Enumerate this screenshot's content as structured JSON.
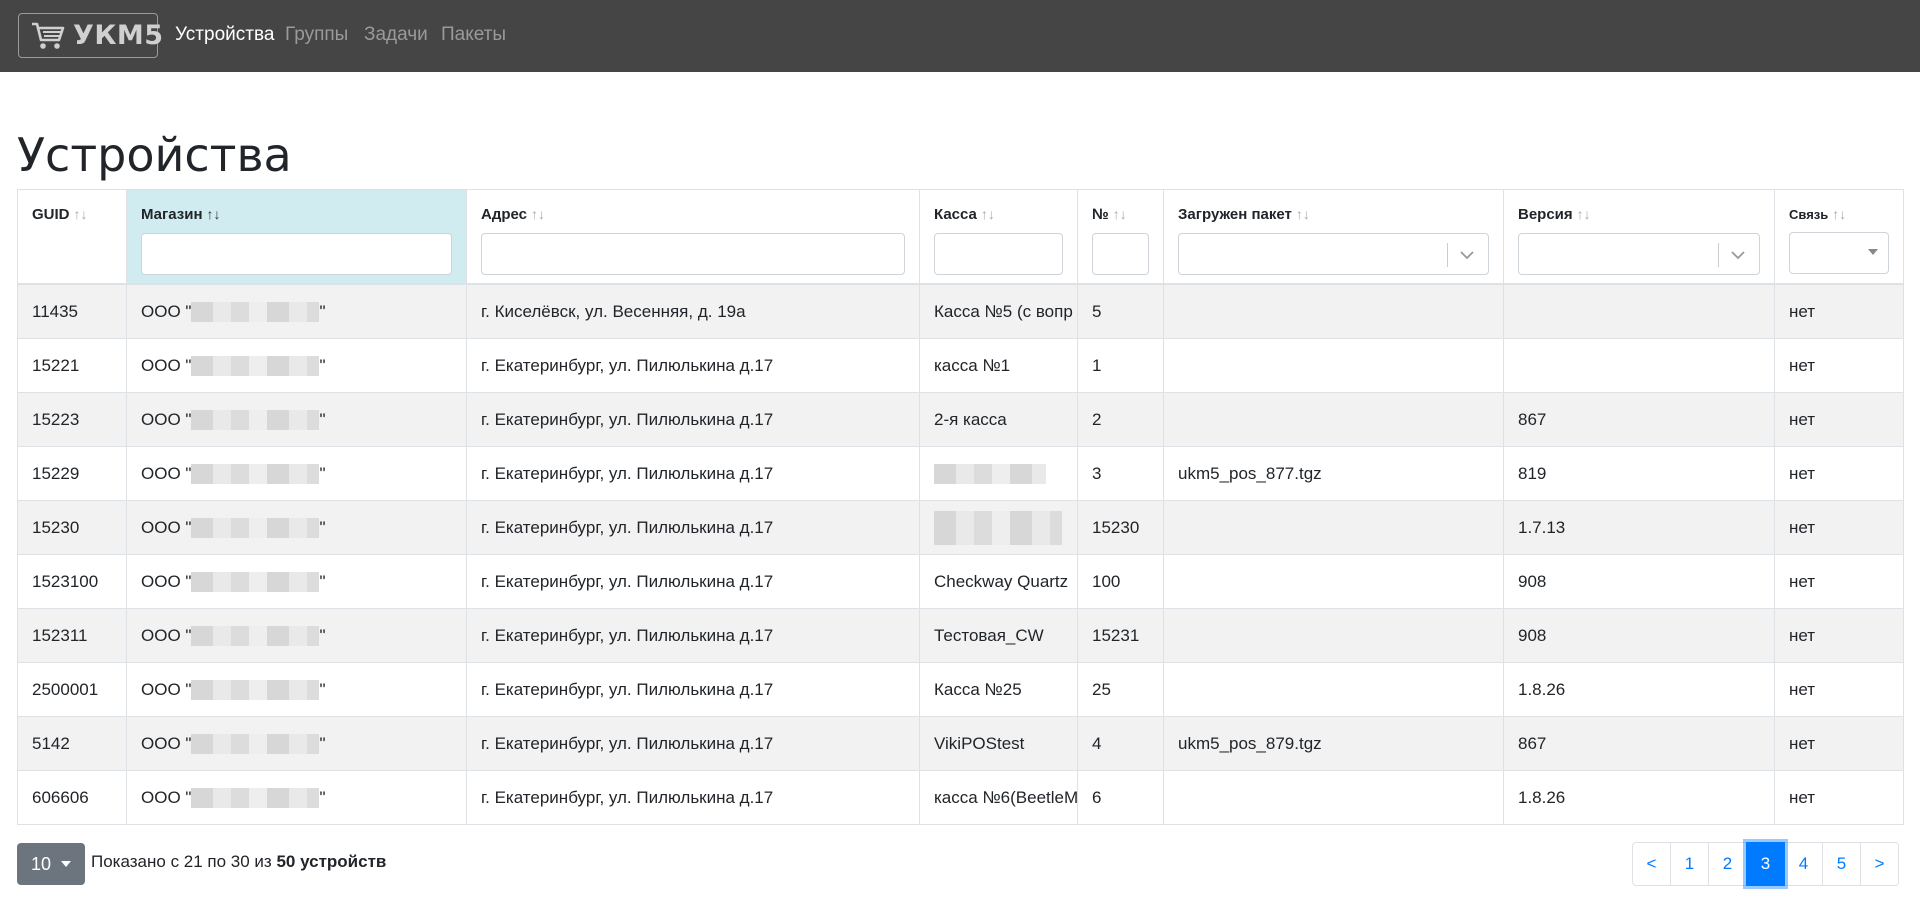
{
  "brand": {
    "name": "УКМ5",
    "icon": "shopping-cart-icon"
  },
  "nav": {
    "items": [
      {
        "label": "Устройства",
        "active": true
      },
      {
        "label": "Группы",
        "active": false
      },
      {
        "label": "Задачи",
        "active": false
      },
      {
        "label": "Пакеты",
        "active": false
      }
    ]
  },
  "page": {
    "title": "Устройства"
  },
  "table": {
    "columns": [
      {
        "label": "GUID",
        "sort": "↑↓",
        "filter": "none"
      },
      {
        "label": "Магазин",
        "sort": "↑↓",
        "filter": "text",
        "sorted": true
      },
      {
        "label": "Адрес",
        "sort": "↑↓",
        "filter": "text"
      },
      {
        "label": "Касса",
        "sort": "↑↓",
        "filter": "text"
      },
      {
        "label": "№",
        "sort": "↑↓",
        "filter": "text"
      },
      {
        "label": "Загружен пакет",
        "sort": "↑↓",
        "filter": "select"
      },
      {
        "label": "Версия",
        "sort": "↑↓",
        "filter": "select"
      },
      {
        "label": "Связь",
        "sort": "↑↓",
        "filter": "native-select"
      }
    ],
    "rows": [
      {
        "guid": "11435",
        "shop_prefix": "ООО \"",
        "shop_suffix": "\"",
        "address": "г. Киселёвск, ул. Весенняя, д. 19а",
        "kassa": "Касса №5 (с вопр",
        "num": "5",
        "package": "",
        "version": "",
        "link": "нет"
      },
      {
        "guid": "15221",
        "shop_prefix": "ООО \"",
        "shop_suffix": "\"",
        "address": "г. Екатеринбург, ул. Пилюлькина д.17",
        "kassa": "касса №1",
        "num": "1",
        "package": "",
        "version": "",
        "link": "нет"
      },
      {
        "guid": "15223",
        "shop_prefix": "ООО \"",
        "shop_suffix": "\"",
        "address": "г. Екатеринбург, ул. Пилюлькина д.17",
        "kassa": "2-я касса",
        "num": "2",
        "package": "",
        "version": "867",
        "link": "нет"
      },
      {
        "guid": "15229",
        "shop_prefix": "ООО \"",
        "shop_suffix": "\"",
        "address": "г. Екатеринбург, ул. Пилюлькина д.17",
        "kassa": "",
        "num": "3",
        "package": "ukm5_pos_877.tgz",
        "version": "819",
        "link": "нет"
      },
      {
        "guid": "15230",
        "shop_prefix": "ООО \"",
        "shop_suffix": "\"",
        "address": "г. Екатеринбург, ул. Пилюлькина д.17",
        "kassa": "",
        "num": "15230",
        "package": "",
        "version": "1.7.13",
        "link": "нет"
      },
      {
        "guid": "1523100",
        "shop_prefix": "ООО \"",
        "shop_suffix": "\"",
        "address": "г. Екатеринбург, ул. Пилюлькина д.17",
        "kassa": "Checkway Quartz",
        "num": "100",
        "package": "",
        "version": "908",
        "link": "нет"
      },
      {
        "guid": "152311",
        "shop_prefix": "ООО \"",
        "shop_suffix": "\"",
        "address": "г. Екатеринбург, ул. Пилюлькина д.17",
        "kassa": "Тестовая_CW",
        "num": "15231",
        "package": "",
        "version": "908",
        "link": "нет"
      },
      {
        "guid": "2500001",
        "shop_prefix": "ООО \"",
        "shop_suffix": "\"",
        "address": "г. Екатеринбург, ул. Пилюлькина д.17",
        "kassa": "Касса №25",
        "num": "25",
        "package": "",
        "version": "1.8.26",
        "link": "нет"
      },
      {
        "guid": "5142",
        "shop_prefix": "ООО \"",
        "shop_suffix": "\"",
        "address": "г. Екатеринбург, ул. Пилюлькина д.17",
        "kassa": "VikiPOStest",
        "num": "4",
        "package": "ukm5_pos_879.tgz",
        "version": "867",
        "link": "нет"
      },
      {
        "guid": "606606",
        "shop_prefix": "ООО \"",
        "shop_suffix": "\"",
        "address": "г. Екатеринбург, ул. Пилюлькина д.17",
        "kassa": "касса №6(BeetleM",
        "num": "6",
        "package": "",
        "version": "1.8.26",
        "link": "нет"
      }
    ]
  },
  "footer": {
    "page_size": "10",
    "summary_prefix": "Показано с 21 по 30 из ",
    "summary_bold": "50 устройств",
    "pagination": [
      "<",
      "1",
      "2",
      "3",
      "4",
      "5",
      ">"
    ],
    "current_page": "3"
  }
}
